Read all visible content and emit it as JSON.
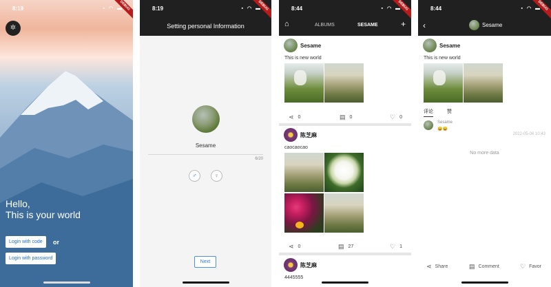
{
  "screens": {
    "login": {
      "status_time": "8:19",
      "greeting_line1": "Hello,",
      "greeting_line2": "This is your world",
      "login_code_label": "Login with code",
      "or_label": "or",
      "login_password_label": "Login with password"
    },
    "profile_setup": {
      "status_time": "8:19",
      "title": "Setting personal Information",
      "name": "Sesame",
      "char_count": "6/20",
      "male_symbol": "♂",
      "female_symbol": "♀",
      "next_label": "Next"
    },
    "feed": {
      "status_time": "8:44",
      "tabs": [
        "ALBUMS",
        "SESAME"
      ],
      "add_symbol": "+",
      "posts": [
        {
          "user": "Sesame",
          "text": "This is new world",
          "shares": "0",
          "comments": "0",
          "likes": "0"
        },
        {
          "user": "陈芝麻",
          "text": "caocaocao",
          "shares": "0",
          "comments": "27",
          "likes": "1"
        },
        {
          "user": "陈芝麻",
          "text": "4445555"
        }
      ]
    },
    "detail": {
      "status_time": "8:44",
      "title": "Sesame",
      "post_user": "Sesame",
      "post_text": "This is new world",
      "subtab_comments": "评论",
      "subtab_likes": "赞",
      "comment": {
        "user": "Sesame",
        "body": "😄😄",
        "time": "2022-05-06 10:43"
      },
      "no_more": "No more data",
      "share_label": "Share",
      "comment_label": "Comment",
      "favor_label": "Favor"
    }
  },
  "debug_banner": "DEBUG"
}
